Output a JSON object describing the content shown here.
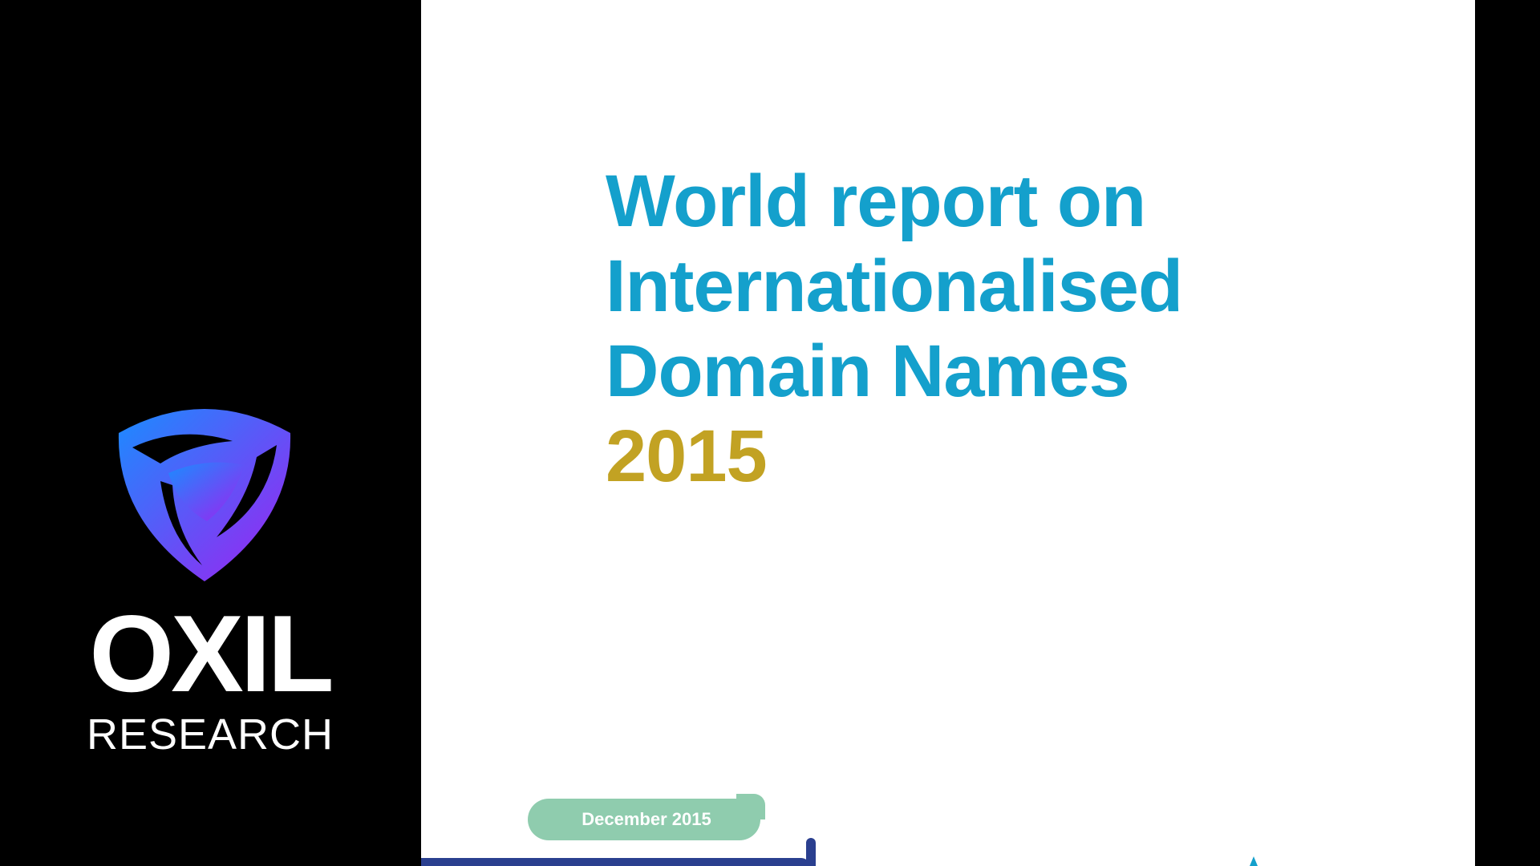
{
  "brand": {
    "name": "OXIL",
    "subtitle": "RESEARCH",
    "logo_icon": "shield-logo-icon",
    "colors": {
      "gradient_start": "#1a8cff",
      "gradient_end": "#a020f0"
    }
  },
  "document": {
    "title_lines": [
      "World report on",
      "Internationalised",
      "Domain Names"
    ],
    "year": "2015",
    "date_label": "December 2015",
    "colors": {
      "title": "#14a0cc",
      "year": "#c2a223",
      "date_pill": "#8fccae",
      "band": "#2a3f8f"
    }
  }
}
